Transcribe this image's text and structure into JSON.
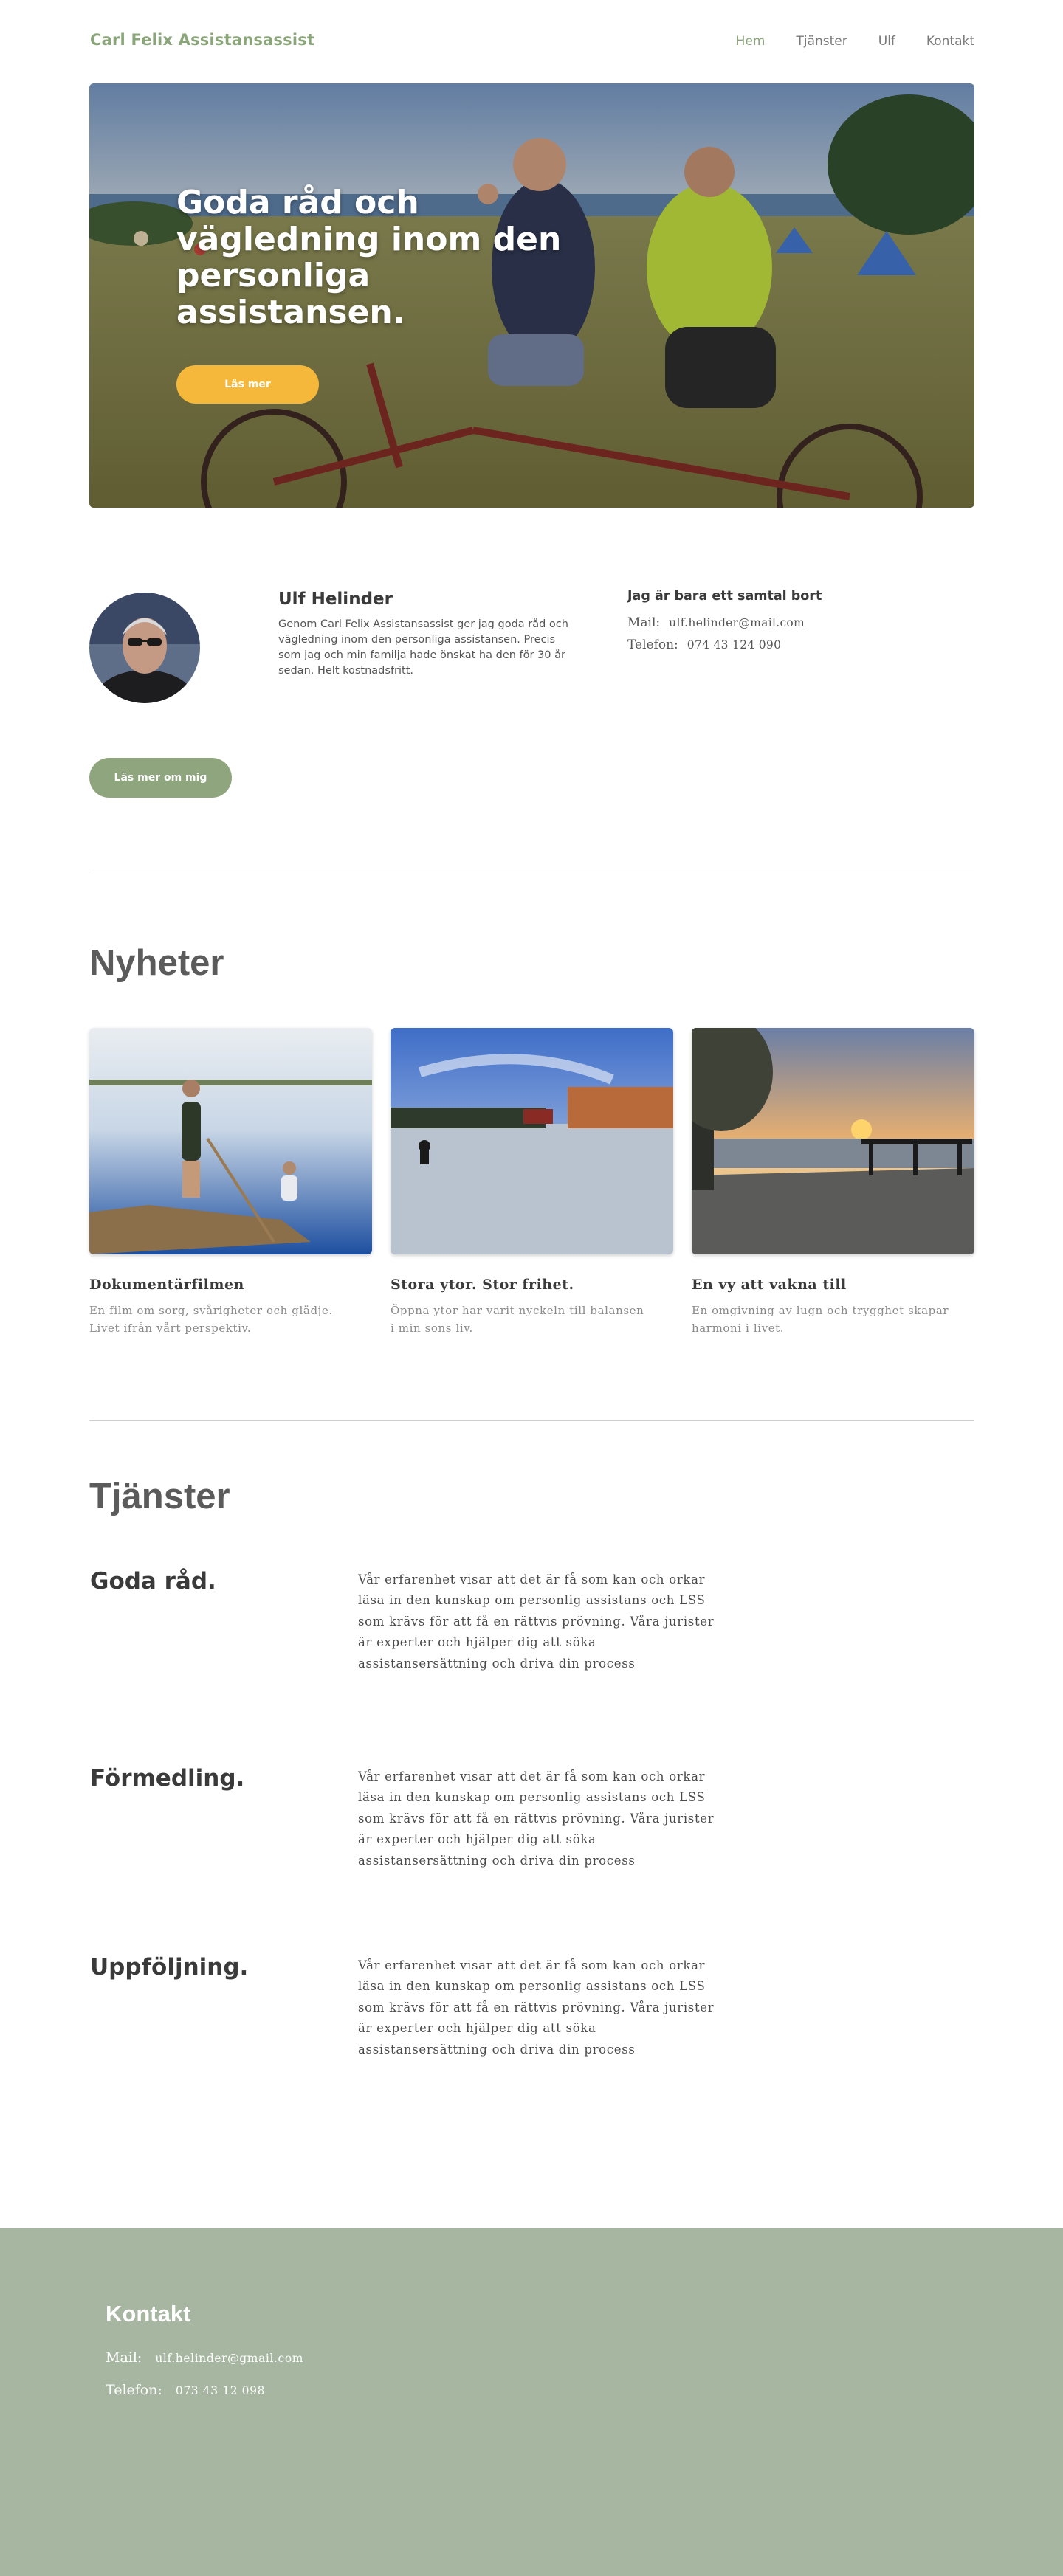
{
  "header": {
    "brand": "Carl Felix Assistansassist",
    "nav": [
      {
        "label": "Hem",
        "active": true
      },
      {
        "label": "Tjänster",
        "active": false
      },
      {
        "label": "Ulf",
        "active": false
      },
      {
        "label": "Kontakt",
        "active": false
      }
    ]
  },
  "hero": {
    "title": "Goda råd och vägledning inom den personliga assistansen.",
    "button_label": "Läs mer"
  },
  "about": {
    "name": "Ulf Helinder",
    "text": "Genom Carl Felix Assistansassist ger jag goda råd och vägledning inom den personliga assistansen. Precis som jag och min familja hade önskat ha den för 30 år sedan. Helt kostnadsfritt.",
    "button_label": "Läs mer om mig",
    "contact_heading": "Jag är bara ett samtal bort",
    "mail_label": "Mail:",
    "mail_value": "ulf.helinder@mail.com",
    "phone_label": "Telefon:",
    "phone_value": "074 43 124 090"
  },
  "news": {
    "title": "Nyheter",
    "items": [
      {
        "title": "Dokumentärfilmen",
        "desc": "En film om sorg, svårigheter och glädje. Livet ifrån vårt perspektiv."
      },
      {
        "title": "Stora ytor. Stor frihet.",
        "desc": "Öppna ytor har varit nyckeln till balansen i min sons liv."
      },
      {
        "title": "En vy att vakna till",
        "desc": "En omgivning av lugn och trygghet skapar harmoni i livet."
      }
    ]
  },
  "services": {
    "title": "Tjänster",
    "items": [
      {
        "title": "Goda råd.",
        "text": "Vår erfarenhet visar att det är få som kan och orkar läsa in den kunskap om personlig assistans och LSS som krävs för att få en rättvis prövning. Våra jurister är experter och hjälper dig att söka assistansersättning och driva din process"
      },
      {
        "title": "Förmedling.",
        "text": "Vår erfarenhet visar att det är få som kan och orkar läsa in den kunskap om personlig assistans och LSS som krävs för att få en rättvis prövning. Våra jurister är experter och hjälper dig att söka assistansersättning och driva din process"
      },
      {
        "title": "Uppföljning.",
        "text": "Vår erfarenhet visar att det är få som kan och orkar läsa in den kunskap om personlig assistans och LSS som krävs för att få en rättvis prövning. Våra jurister är experter och hjälper dig att söka assistansersättning och driva din process"
      }
    ]
  },
  "footer": {
    "title": "Kontakt",
    "mail_label": "Mail:",
    "mail_value": "ulf.helinder@gmail.com",
    "phone_label": "Telefon:",
    "phone_value": "073 43 12 098"
  },
  "colors": {
    "brand_green": "#8aa57a",
    "button_yellow": "#f6b83a",
    "button_green": "#8ea57e",
    "footer_bg": "#a7b6a1"
  }
}
